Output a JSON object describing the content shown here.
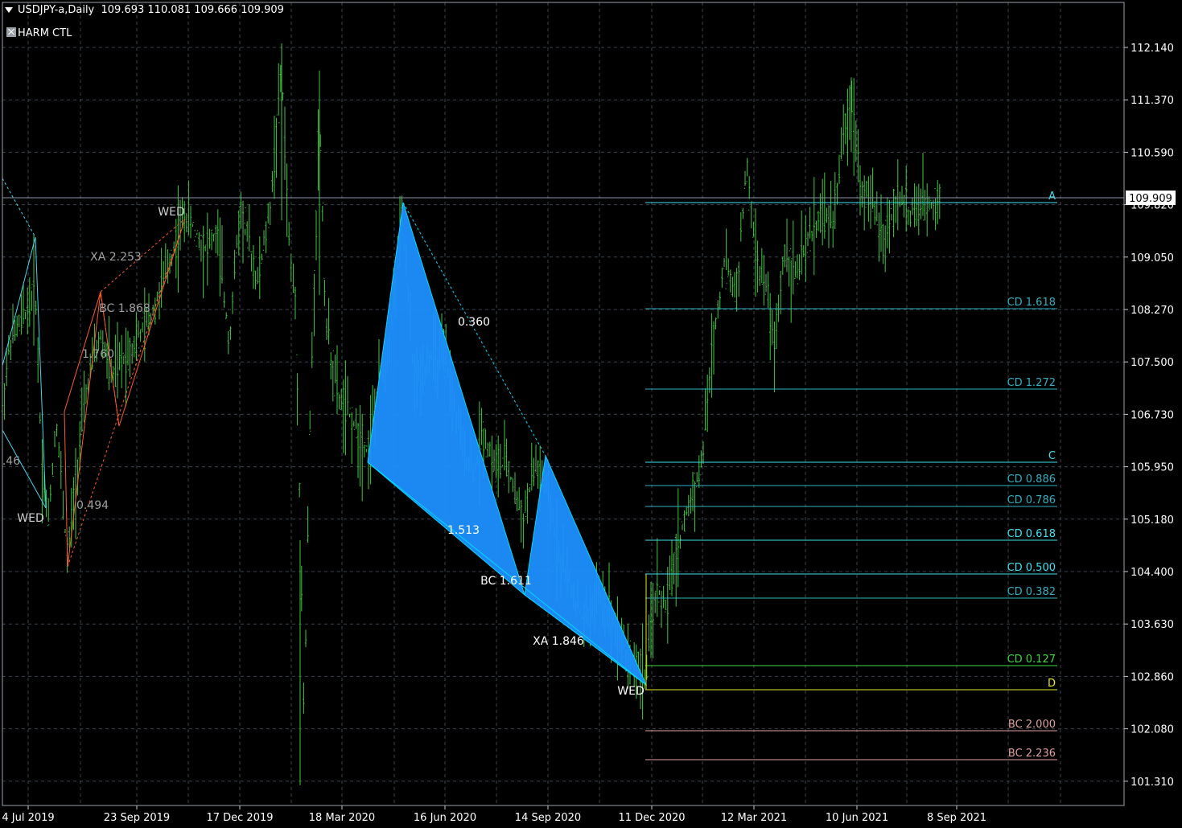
{
  "header": {
    "symbol_timeframe": "USDJPY-a,Daily",
    "ohlc": "109.693 110.081 109.666 109.909"
  },
  "indicator": {
    "label": "HARM CTL",
    "icon": "indicator-icon"
  },
  "price_axis": {
    "ticks": [
      "112.140",
      "111.370",
      "110.590",
      "109.820",
      "109.050",
      "108.270",
      "107.500",
      "106.730",
      "105.950",
      "105.180",
      "104.400",
      "103.630",
      "102.860",
      "102.080",
      "101.310"
    ],
    "current_price": "109.909"
  },
  "time_axis": {
    "labels": [
      "4 Jul 2019",
      "23 Sep 2019",
      "17 Dec 2019",
      "18 Mar 2020",
      "16 Jun 2020",
      "14 Sep 2020",
      "11 Dec 2020",
      "12 Mar 2021",
      "10 Jun 2021",
      "8 Sep 2021"
    ]
  },
  "levels": [
    {
      "label": "A",
      "price": 109.86,
      "color": "#40e0f0"
    },
    {
      "label": "CD 1.618",
      "price": 108.3,
      "color": "#30b0c0"
    },
    {
      "label": "CD 1.272",
      "price": 107.12,
      "color": "#30b0c0"
    },
    {
      "label": "C",
      "price": 106.05,
      "color": "#40e0f0"
    },
    {
      "label": "CD 0.886",
      "price": 105.7,
      "color": "#30b0c0"
    },
    {
      "label": "CD 0.786",
      "price": 105.4,
      "color": "#30b0c0"
    },
    {
      "label": "CD 0.618",
      "price": 104.9,
      "color": "#40e0f0"
    },
    {
      "label": "CD 0.500",
      "price": 104.4,
      "color": "#40e0f0"
    },
    {
      "label": "CD 0.382",
      "price": 104.05,
      "color": "#30b0c0"
    },
    {
      "label": "CD 0.127",
      "price": 103.06,
      "color": "#3fd83f"
    },
    {
      "label": "D",
      "price": 102.7,
      "color": "#e8e820"
    },
    {
      "label": "BC 2.000",
      "price": 102.1,
      "color": "#e0a0a0"
    },
    {
      "label": "BC 2.236",
      "price": 101.68,
      "color": "#e0a0a0"
    }
  ],
  "annotations": {
    "wed_top": "WED",
    "wed_left": "WED",
    "wed_bottom": "WED",
    "xa_2253": "XA 2.253",
    "bc_1868": "BC 1.868",
    "r_1760": "1.760",
    "r_0494": "0.494",
    "r_0360": "0.360",
    "r_1513": "1.513",
    "bc_1611": "BC 1.611",
    "xa_1846": "XA 1.846",
    "r_46": ".46"
  },
  "colors": {
    "background": "#000000",
    "grid": "#3c4650",
    "candles": "#3fc83f",
    "pattern_fill": "#1e90ff",
    "pattern_line": "#00d8ff",
    "old_pattern_line": "#ff5a2a"
  }
}
